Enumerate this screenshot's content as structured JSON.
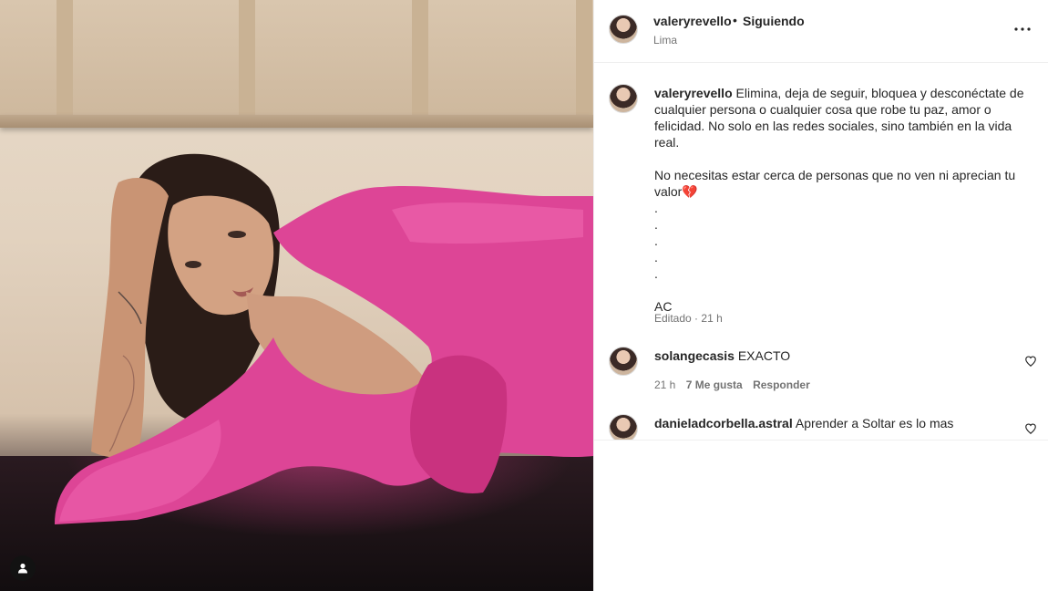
{
  "header": {
    "username": "valeryrevello",
    "separator": "•",
    "follow_status": "Siguiendo",
    "location": "Lima",
    "more_icon": "more-horizontal-icon"
  },
  "caption": {
    "username": "valeryrevello",
    "text": "Elimina, deja de seguir, bloquea y desconéctate de cualquier persona o cualquier cosa que robe tu paz, amor o felicidad. No solo en las redes sociales, sino también en la vida real.\n\nNo necesitas estar cerca de personas que no ven ni aprecian tu valor💔\n.\n.\n.\n.\n.\n\nAC",
    "edited_label": "Editado",
    "meta_separator": "·",
    "time": "21 h"
  },
  "comments": [
    {
      "username": "solangecasis",
      "text": "EXACTO",
      "time": "21 h",
      "likes": "7 Me gusta",
      "reply_label": "Responder"
    },
    {
      "username": "danieladcorbella.astral",
      "text": "Aprender a Soltar es lo mas"
    }
  ],
  "media": {
    "user_tag_icon": "user-tag-icon"
  },
  "colors": {
    "text": "#262626",
    "secondary": "#737373",
    "border": "#efefef",
    "dress": "#e0489a"
  }
}
